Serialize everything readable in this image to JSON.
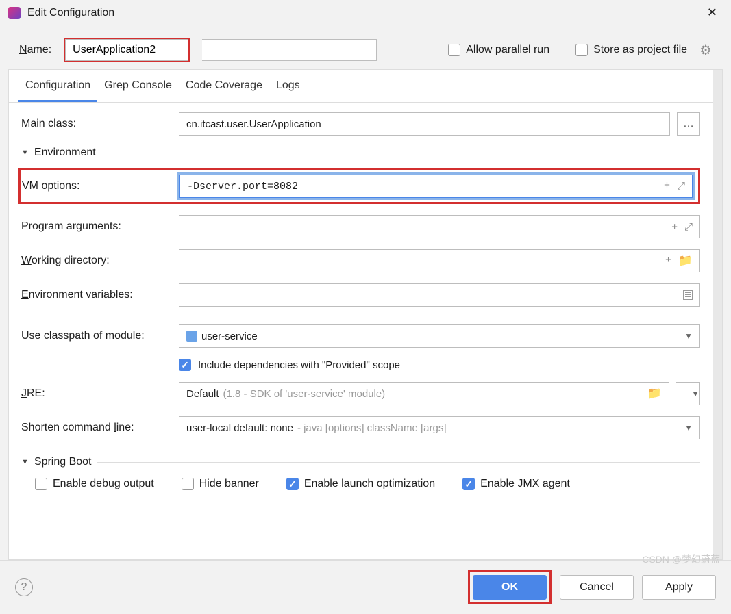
{
  "window": {
    "title": "Edit Configuration"
  },
  "name": {
    "label_prefix": "N",
    "label_rest": "ame:",
    "value": "UserApplication2"
  },
  "options": {
    "allow_parallel_prefix": "Allow parallel r",
    "allow_parallel_u": "u",
    "allow_parallel_rest": "n",
    "store_prefix": "S",
    "store_rest": "tore as project file"
  },
  "tabs": {
    "t0": "Configuration",
    "t1": "Grep Console",
    "t2": "Code Coverage",
    "t3": "Logs"
  },
  "form": {
    "main_class_label": "Main class:",
    "main_class_value": "cn.itcast.user.UserApplication",
    "env_section_prefix": "Environ",
    "env_section_u": "m",
    "env_section_rest": "ent",
    "vm_label_u": "V",
    "vm_label_rest": "M options:",
    "vm_value": "-Dserver.port=8082",
    "prog_args_label": "Program ar",
    "prog_args_u": "g",
    "prog_args_rest": "uments:",
    "workdir_u": "W",
    "workdir_rest": "orking directory:",
    "envvars_u": "E",
    "envvars_rest": "nvironment variables:",
    "classpath_prefix": "Use classpath of m",
    "classpath_u": "o",
    "classpath_rest": "dule:",
    "classpath_value": "user-service",
    "include_provided": "Include dependencies with \"Provided\" scope",
    "jre_u": "J",
    "jre_rest": "RE:",
    "jre_value": "Default ",
    "jre_gray": "(1.8 - SDK of 'user-service' module)",
    "shorten_label": "Shorten command ",
    "shorten_u": "l",
    "shorten_rest": "ine:",
    "shorten_value": "user-local default: none ",
    "shorten_gray": "- java [options] className [args]",
    "springboot_section": "Spring Boot",
    "enable_debug": "Enable debug output",
    "hide_banner": "Hide banner",
    "enable_launch": "Enable launch optimization",
    "enable_jmx": "Enable JMX agent"
  },
  "footer": {
    "ok": "OK",
    "cancel": "Cancel",
    "apply": "Apply"
  },
  "watermark": "CSDN @梦幻蔚蓝"
}
